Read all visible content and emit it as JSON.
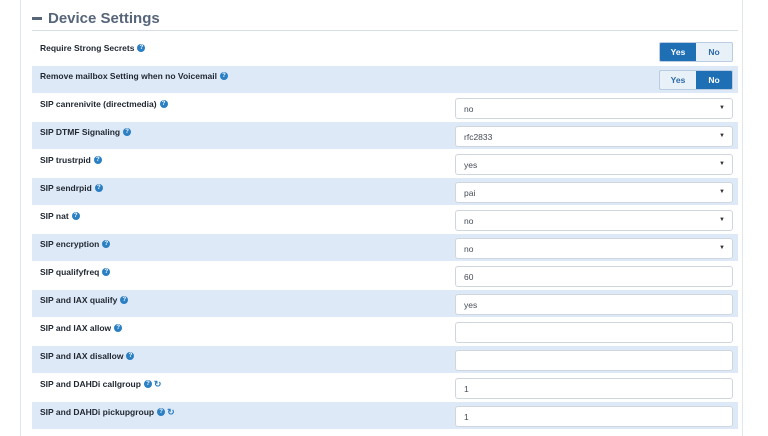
{
  "section": {
    "title": "Device Settings"
  },
  "colors": {
    "accent": "#1f6fb5",
    "row_alt": "#dde9f7",
    "header": "#56657a"
  },
  "settings": [
    {
      "label": "Require Strong Secrets",
      "type": "toggle",
      "options": [
        "Yes",
        "No"
      ],
      "selected": "Yes",
      "icons": [
        "help-icon"
      ]
    },
    {
      "label": "Remove mailbox Setting when no Voicemail",
      "type": "toggle",
      "options": [
        "Yes",
        "No"
      ],
      "selected": "No",
      "icons": [
        "help-icon"
      ]
    },
    {
      "label": "SIP canrenivite (directmedia)",
      "type": "select",
      "value": "no",
      "icons": [
        "help-icon"
      ]
    },
    {
      "label": "SIP DTMF Signaling",
      "type": "select",
      "value": "rfc2833",
      "icons": [
        "help-icon"
      ]
    },
    {
      "label": "SIP trustrpid",
      "type": "select",
      "value": "yes",
      "icons": [
        "help-icon"
      ]
    },
    {
      "label": "SIP sendrpid",
      "type": "select",
      "value": "pai",
      "icons": [
        "help-icon"
      ]
    },
    {
      "label": "SIP nat",
      "type": "select",
      "value": "no",
      "icons": [
        "help-icon"
      ]
    },
    {
      "label": "SIP encryption",
      "type": "select",
      "value": "no",
      "icons": [
        "help-icon"
      ]
    },
    {
      "label": "SIP qualifyfreq",
      "type": "text",
      "value": "60",
      "icons": [
        "help-icon"
      ]
    },
    {
      "label": "SIP and IAX qualify",
      "type": "text",
      "value": "yes",
      "icons": [
        "help-icon"
      ]
    },
    {
      "label": "SIP and IAX allow",
      "type": "text",
      "value": "",
      "icons": [
        "help-icon"
      ]
    },
    {
      "label": "SIP and IAX disallow",
      "type": "text",
      "value": "",
      "icons": [
        "help-icon"
      ]
    },
    {
      "label": "SIP and DAHDi callgroup",
      "type": "text",
      "value": "1",
      "icons": [
        "help-icon",
        "refresh-icon"
      ]
    },
    {
      "label": "SIP and DAHDi pickupgroup",
      "type": "text",
      "value": "1",
      "icons": [
        "help-icon",
        "refresh-icon"
      ]
    }
  ]
}
